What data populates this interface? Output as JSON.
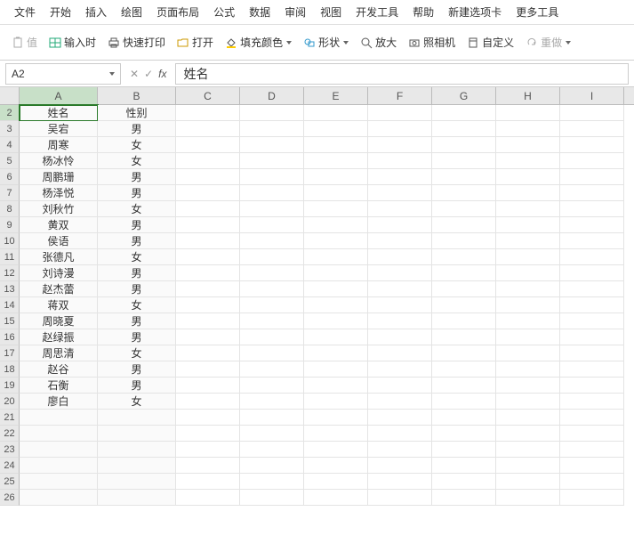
{
  "menu": [
    "文件",
    "开始",
    "插入",
    "绘图",
    "页面布局",
    "公式",
    "数据",
    "审阅",
    "视图",
    "开发工具",
    "帮助",
    "新建选项卡",
    "更多工具"
  ],
  "toolbar": {
    "paste_value": "值",
    "input_time": "输入时",
    "quick_print": "快速打印",
    "open": "打开",
    "fill_color": "填充颜色",
    "shape": "形状",
    "zoom_in": "放大",
    "camera": "照相机",
    "custom": "自定义",
    "redo": "重做"
  },
  "namebox": "A2",
  "formula_value": "姓名",
  "columns": [
    "A",
    "B",
    "C",
    "D",
    "E",
    "F",
    "G",
    "H",
    "I"
  ],
  "row_start": 2,
  "row_end": 26,
  "table": {
    "headers": [
      "姓名",
      "性别"
    ],
    "rows": [
      [
        "吴宕",
        "男"
      ],
      [
        "周寒",
        "女"
      ],
      [
        "杨冰怜",
        "女"
      ],
      [
        "周鹏珊",
        "男"
      ],
      [
        "杨泽悦",
        "男"
      ],
      [
        "刘秋竹",
        "女"
      ],
      [
        "黄双",
        "男"
      ],
      [
        "侯语",
        "男"
      ],
      [
        "张德凡",
        "女"
      ],
      [
        "刘诗漫",
        "男"
      ],
      [
        "赵杰蕾",
        "男"
      ],
      [
        "蒋双",
        "女"
      ],
      [
        "周晓夏",
        "男"
      ],
      [
        "赵绿振",
        "男"
      ],
      [
        "周思清",
        "女"
      ],
      [
        "赵谷",
        "男"
      ],
      [
        "石衡",
        "男"
      ],
      [
        "廖白",
        "女"
      ]
    ]
  }
}
